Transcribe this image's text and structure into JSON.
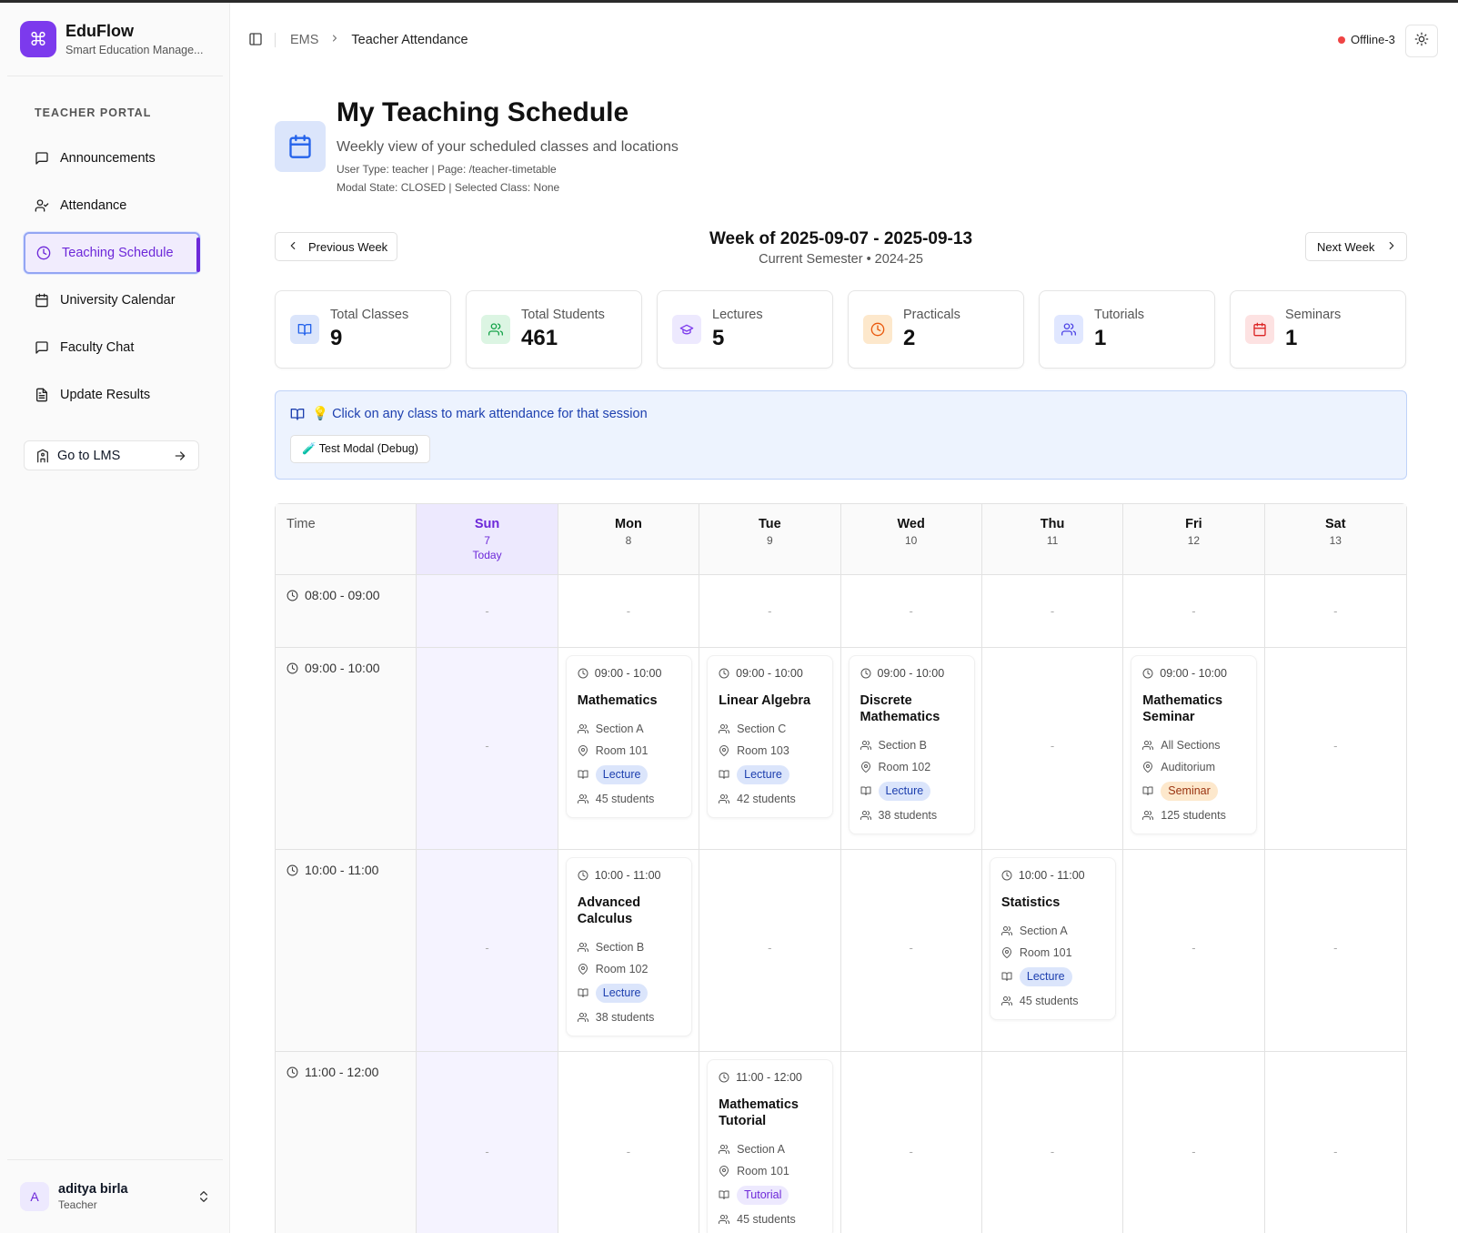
{
  "brand": {
    "name": "EduFlow",
    "subtitle": "Smart Education Manage..."
  },
  "sidebar": {
    "section_label": "TEACHER PORTAL",
    "items": [
      {
        "label": "Announcements",
        "icon": "message-square-icon"
      },
      {
        "label": "Attendance",
        "icon": "user-check-icon"
      },
      {
        "label": "Teaching Schedule",
        "icon": "clock-icon",
        "active": true
      },
      {
        "label": "University Calendar",
        "icon": "calendar-icon"
      },
      {
        "label": "Faculty Chat",
        "icon": "message-square-icon"
      },
      {
        "label": "Update Results",
        "icon": "file-text-icon"
      }
    ],
    "lms_button": "Go to LMS",
    "user": {
      "initial": "A",
      "name": "aditya birla",
      "role": "Teacher"
    }
  },
  "header": {
    "breadcrumb": [
      "EMS",
      "Teacher Attendance"
    ],
    "status": "Offline-3",
    "status_color": "#ef4444"
  },
  "page": {
    "title": "My Teaching Schedule",
    "subtitle": "Weekly view of your scheduled classes and locations",
    "debug_line1": "User Type: teacher | Page: /teacher-timetable",
    "debug_line2": "Modal State: CLOSED | Selected Class: None"
  },
  "week": {
    "prev_label": "Previous Week",
    "next_label": "Next Week",
    "title": "Week of 2025-09-07 - 2025-09-13",
    "subtitle": "Current Semester • 2024-25"
  },
  "stats": [
    {
      "label": "Total Classes",
      "value": "9",
      "icon": "book-open-icon",
      "bg": "#dbe5fb",
      "fg": "#2563eb"
    },
    {
      "label": "Total Students",
      "value": "461",
      "icon": "users-icon",
      "bg": "#dcf5e3",
      "fg": "#16a34a"
    },
    {
      "label": "Lectures",
      "value": "5",
      "icon": "graduation-cap-icon",
      "bg": "#ede9fe",
      "fg": "#7c3aed"
    },
    {
      "label": "Practicals",
      "value": "2",
      "icon": "clock-icon",
      "bg": "#fde8cc",
      "fg": "#ea580c"
    },
    {
      "label": "Tutorials",
      "value": "1",
      "icon": "users-icon",
      "bg": "#e0e7ff",
      "fg": "#4f46e5"
    },
    {
      "label": "Seminars",
      "value": "1",
      "icon": "calendar-icon",
      "bg": "#fde2e2",
      "fg": "#dc2626"
    }
  ],
  "info": {
    "text": "💡 Click on any class to mark attendance for that session",
    "debug_button": "🧪 Test Modal (Debug)"
  },
  "timetable": {
    "time_header": "Time",
    "today_label": "Today",
    "empty": "-",
    "days": [
      {
        "name": "Sun",
        "date": "7",
        "today": true
      },
      {
        "name": "Mon",
        "date": "8"
      },
      {
        "name": "Tue",
        "date": "9"
      },
      {
        "name": "Wed",
        "date": "10"
      },
      {
        "name": "Thu",
        "date": "11"
      },
      {
        "name": "Fri",
        "date": "12"
      },
      {
        "name": "Sat",
        "date": "13"
      }
    ],
    "slots": [
      {
        "time": "08:00 - 09:00",
        "classes": [
          null,
          null,
          null,
          null,
          null,
          null,
          null
        ]
      },
      {
        "time": "09:00 - 10:00",
        "classes": [
          null,
          {
            "time": "09:00 - 10:00",
            "subject": "Mathematics",
            "section": "Section A",
            "room": "Room 101",
            "type": "Lecture",
            "students": "45 students"
          },
          {
            "time": "09:00 - 10:00",
            "subject": "Linear Algebra",
            "section": "Section C",
            "room": "Room 103",
            "type": "Lecture",
            "students": "42 students"
          },
          {
            "time": "09:00 - 10:00",
            "subject": "Discrete Mathematics",
            "section": "Section B",
            "room": "Room 102",
            "type": "Lecture",
            "students": "38 students"
          },
          null,
          {
            "time": "09:00 - 10:00",
            "subject": "Mathematics Seminar",
            "section": "All Sections",
            "room": "Auditorium",
            "type": "Seminar",
            "students": "125 students"
          },
          null
        ]
      },
      {
        "time": "10:00 - 11:00",
        "classes": [
          null,
          {
            "time": "10:00 - 11:00",
            "subject": "Advanced Calculus",
            "section": "Section B",
            "room": "Room 102",
            "type": "Lecture",
            "students": "38 students"
          },
          null,
          null,
          {
            "time": "10:00 - 11:00",
            "subject": "Statistics",
            "section": "Section A",
            "room": "Room 101",
            "type": "Lecture",
            "students": "45 students"
          },
          null,
          null
        ]
      },
      {
        "time": "11:00 - 12:00",
        "classes": [
          null,
          null,
          {
            "time": "11:00 - 12:00",
            "subject": "Mathematics Tutorial",
            "section": "Section A",
            "room": "Room 101",
            "type": "Tutorial",
            "students": "45 students"
          },
          null,
          null,
          null,
          null
        ]
      }
    ]
  }
}
